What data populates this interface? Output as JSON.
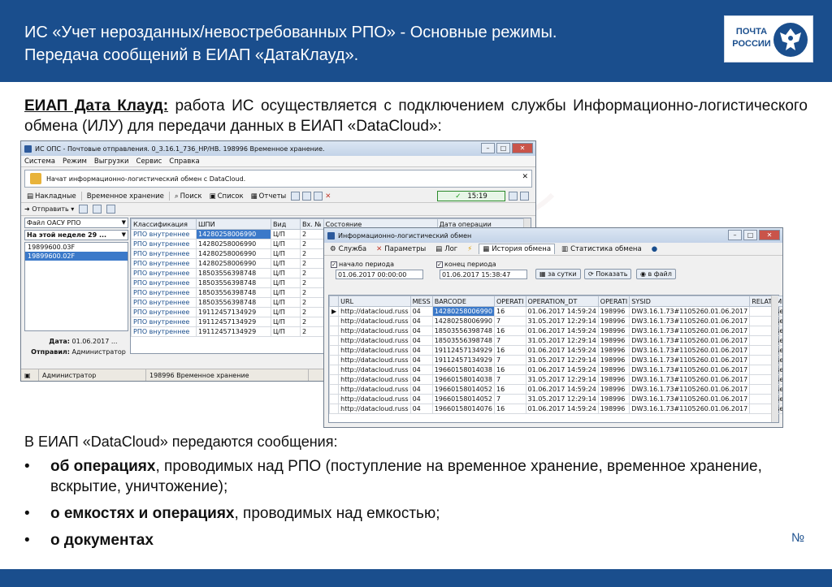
{
  "slide": {
    "title_line1": "ИС «Учет нерозданных/невостребованных РПО» - Основные режимы.",
    "title_line2": "Передача  сообщений в ЕИАП «ДатаКлауд».",
    "logo_line1": "ПОЧТА",
    "logo_line2": "РОССИИ",
    "intro_bold": "ЕИАП Дата Клауд:",
    "intro_rest": " работа ИС осуществляется с подключением службы Информационно-логистического обмена (ИЛУ) для передачи данных в ЕИАП «DataCloud»:",
    "lower_heading": "В ЕИАП «DataCloud» передаются сообщения:",
    "bullets": [
      {
        "bold": "об операциях",
        "rest": ", проводимых над РПО (поступление на временное хранение, временное хранение, вскрытие, уничтожение);"
      },
      {
        "bold": "о емкостях и операциях",
        "rest": ", проводимых над емкостью;"
      },
      {
        "bold": "о документах",
        "rest": ""
      }
    ],
    "slide_number": "№",
    "colors": {
      "brand_blue": "#1a4e8d"
    }
  },
  "win1": {
    "title": "ИС ОПС - Почтовые отправления. 0_3.16.1_736_НР/НВ. 198996 Временное хранение.",
    "menu": [
      "Система",
      "Режим",
      "Выгрузки",
      "Сервис",
      "Справка"
    ],
    "info_text": "Начат информационно-логистический обмен с DataCloud.",
    "tabs": [
      "Накладные",
      "Временное хранение",
      "Поиск",
      "Список",
      "Отчеты"
    ],
    "clock_time": "15:19",
    "send_label": "Отправить",
    "file_combo": "Файл ОАСУ РПО",
    "week_combo": "На этой неделе 29 ...",
    "files": [
      "19899600.03F",
      "19899600.02F"
    ],
    "date_label": "Дата:",
    "date_value": "01.06.2017 ...",
    "sender_label": "Отправил:",
    "sender_value": "Администратор",
    "status_user": "Администратор",
    "status_mode": "198996 Временное хранение",
    "columns": [
      "Классификация",
      "ШПИ",
      "Вид",
      "Вх. №",
      "Состояние",
      "Дата операции"
    ],
    "rows": [
      [
        "РПО внутреннее",
        "14280258006990",
        "Ц/П",
        "2"
      ],
      [
        "РПО внутреннее",
        "14280258006990",
        "Ц/П",
        "2"
      ],
      [
        "РПО внутреннее",
        "14280258006990",
        "Ц/П",
        "2"
      ],
      [
        "РПО внутреннее",
        "14280258006990",
        "Ц/П",
        "2"
      ],
      [
        "РПО внутреннее",
        "18503556398748",
        "Ц/П",
        "2"
      ],
      [
        "РПО внутреннее",
        "18503556398748",
        "Ц/П",
        "2"
      ],
      [
        "РПО внутреннее",
        "18503556398748",
        "Ц/П",
        "2"
      ],
      [
        "РПО внутреннее",
        "18503556398748",
        "Ц/П",
        "2"
      ],
      [
        "РПО внутреннее",
        "19112457134929",
        "Ц/П",
        "2"
      ],
      [
        "РПО внутреннее",
        "19112457134929",
        "Ц/П",
        "2"
      ],
      [
        "РПО внутреннее",
        "19112457134929",
        "Ц/П",
        "2"
      ]
    ]
  },
  "win2": {
    "title": "Информационно-логистический обмен",
    "tabs": [
      "Служба",
      "Параметры",
      "Лог",
      "История обмена",
      "Статистика обмена"
    ],
    "start_label": "начало периода",
    "start_value": "01.06.2017 00:00:00",
    "end_label": "конец периода",
    "end_value": "01.06.2017 15:38:47",
    "btn_day": "за сутки",
    "btn_show": "Показать",
    "btn_file": "в файл",
    "columns": [
      "URL",
      "MESS",
      "BARCODE",
      "OPERATI",
      "OPERATION_DT",
      "OPERATI",
      "SYSID",
      "RELAT",
      "МЕТ"
    ],
    "rows": [
      [
        "http://datacloud.russ",
        "04",
        "14280258006990",
        "16",
        "01.06.2017 14:59:24",
        "198996",
        "DW3.16.1.73#1105260.01.06.2017",
        "",
        "send"
      ],
      [
        "http://datacloud.russ",
        "04",
        "14280258006990",
        "7",
        "31.05.2017 12:29:14",
        "198996",
        "DW3.16.1.73#1105260.01.06.2017",
        "",
        "send"
      ],
      [
        "http://datacloud.russ",
        "04",
        "18503556398748",
        "16",
        "01.06.2017 14:59:24",
        "198996",
        "DW3.16.1.73#1105260.01.06.2017",
        "",
        "send"
      ],
      [
        "http://datacloud.russ",
        "04",
        "18503556398748",
        "7",
        "31.05.2017 12:29:14",
        "198996",
        "DW3.16.1.73#1105260.01.06.2017",
        "",
        "send"
      ],
      [
        "http://datacloud.russ",
        "04",
        "19112457134929",
        "16",
        "01.06.2017 14:59:24",
        "198996",
        "DW3.16.1.73#1105260.01.06.2017",
        "",
        "send"
      ],
      [
        "http://datacloud.russ",
        "04",
        "19112457134929",
        "7",
        "31.05.2017 12:29:14",
        "198996",
        "DW3.16.1.73#1105260.01.06.2017",
        "",
        "send"
      ],
      [
        "http://datacloud.russ",
        "04",
        "19660158014038",
        "16",
        "01.06.2017 14:59:24",
        "198996",
        "DW3.16.1.73#1105260.01.06.2017",
        "",
        "send"
      ],
      [
        "http://datacloud.russ",
        "04",
        "19660158014038",
        "7",
        "31.05.2017 12:29:14",
        "198996",
        "DW3.16.1.73#1105260.01.06.2017",
        "",
        "send"
      ],
      [
        "http://datacloud.russ",
        "04",
        "19660158014052",
        "16",
        "01.06.2017 14:59:24",
        "198996",
        "DW3.16.1.73#1105260.01.06.2017",
        "",
        "send"
      ],
      [
        "http://datacloud.russ",
        "04",
        "19660158014052",
        "7",
        "31.05.2017 12:29:14",
        "198996",
        "DW3.16.1.73#1105260.01.06.2017",
        "",
        "send"
      ],
      [
        "http://datacloud.russ",
        "04",
        "19660158014076",
        "16",
        "01.06.2017 14:59:24",
        "198996",
        "DW3.16.1.73#1105260.01.06.2017",
        "",
        "send"
      ]
    ]
  }
}
